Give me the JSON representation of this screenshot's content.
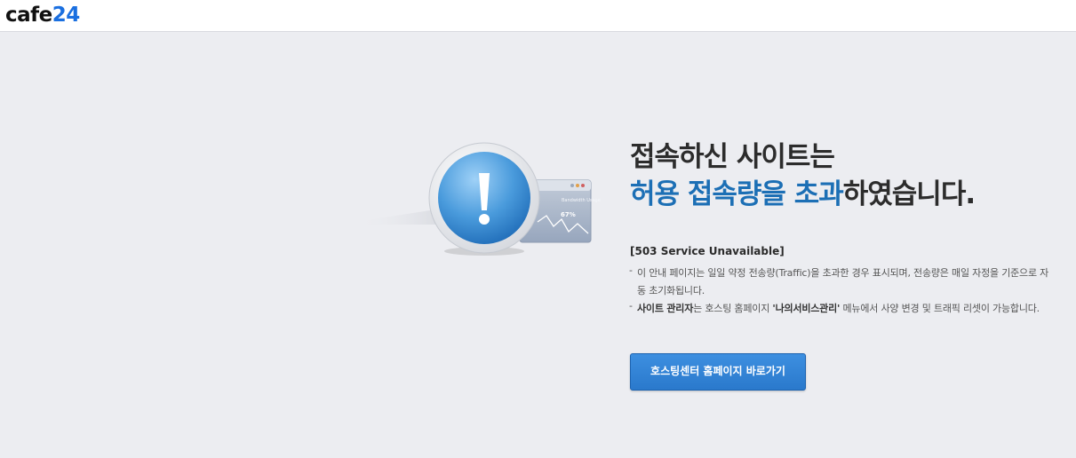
{
  "header": {
    "logo_part1": "cafe",
    "logo_part2": "24"
  },
  "illustration": {
    "icon": "exclamation-icon",
    "graph_label": "67%",
    "graph_caption": "Bandwidth Usage"
  },
  "main": {
    "title_line1": "접속하신 사이트는",
    "title_highlight": "허용 접속량을 초과",
    "title_rest": "하였습니다.",
    "status": "[503 Service Unavailable]",
    "note1": "이 안내 페이지는 일일 약정 전송량(Traffic)을 초과한 경우 표시되며, 전송량은 매일 자정을 기준으로 자동 초기화됩니다.",
    "note2_bold1": "사이트 관리자",
    "note2_text1": "는 호스팅 홈페이지 ",
    "note2_bold2": "'나의서비스관리'",
    "note2_text2": " 메뉴에서 사양 변경 및 트래픽 리셋이 가능합니다.",
    "button_label": "호스팅센터 홈페이지 바로가기"
  },
  "colors": {
    "accent": "#1c6fb5",
    "button": "#2f80d1",
    "background": "#ecedf1"
  }
}
